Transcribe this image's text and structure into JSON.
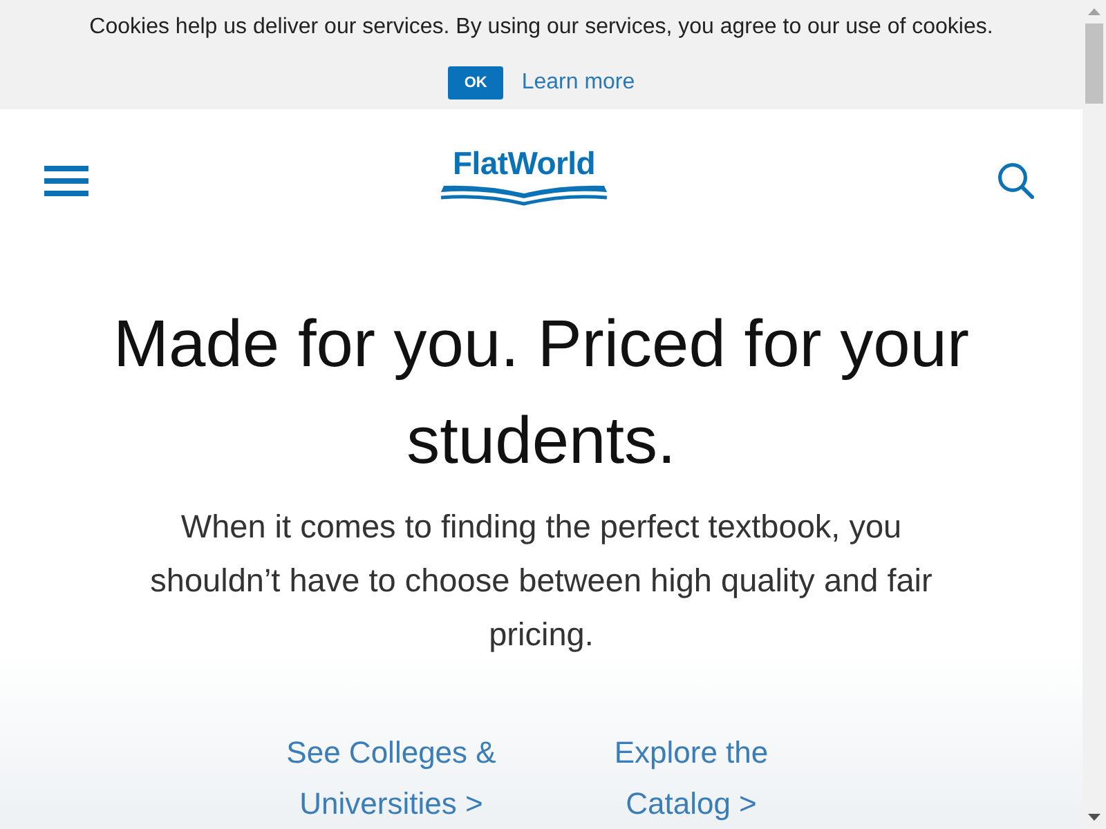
{
  "cookie_banner": {
    "message": "Cookies help us deliver our services. By using our services, you agree to our use of cookies.",
    "buttons": [
      {
        "kind": "primary",
        "label": "OK"
      },
      {
        "kind": "link",
        "label": "Learn more"
      }
    ]
  },
  "header": {
    "logo": "FlatWorld"
  },
  "hero": {
    "headline": "Made for you. Priced for your students.",
    "subtitle": "When it comes to finding the perfect textbook, you shouldn’t have to choose between high quality and fair pricing.",
    "links": [
      "See Colleges & Universities >",
      "Explore the Catalog >"
    ]
  }
}
